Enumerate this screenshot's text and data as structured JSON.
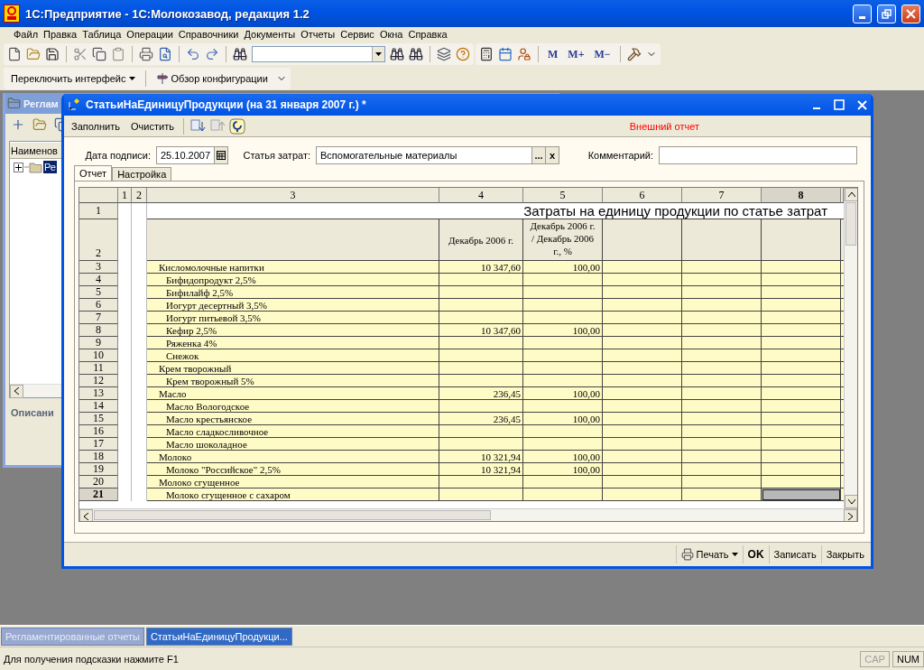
{
  "window": {
    "title": "1С:Предприятие - 1С:Молокозавод, редакция 1.2"
  },
  "menu": [
    "Файл",
    "Правка",
    "Таблица",
    "Операции",
    "Справочники",
    "Документы",
    "Отчеты",
    "Сервис",
    "Окна",
    "Справка"
  ],
  "toolbar": {
    "memory_buttons": [
      "M",
      "M+",
      "M−"
    ]
  },
  "toolbar2": {
    "interface_button": "Переключить интерфейс",
    "config_button": "Обзор конфигурации"
  },
  "background_window": {
    "title": "Реглам",
    "column": "Наименов",
    "tree_item": {
      "label": "Ре",
      "selected": true,
      "expanded": false
    },
    "section": "Описани"
  },
  "dialog": {
    "title": "СтатьиНаЕдиницуПродукции (на 31 января 2007 г.) *",
    "toolbar": [
      "Заполнить",
      "Очистить"
    ],
    "note": "Внешний отчет",
    "fields": {
      "date": {
        "label": "Дата подписи:",
        "value": "25.10.2007"
      },
      "cost_item": {
        "label": "Статья затрат:",
        "value": "Вспомогательные материалы",
        "select_button": "...",
        "clear_button": "x"
      },
      "comment": {
        "label": "Комментарий:"
      }
    },
    "tabs": [
      {
        "label": "Отчет",
        "selected": true
      },
      {
        "label": "Настройка",
        "selected": false
      }
    ],
    "sheet": {
      "columns": [
        {
          "label": "1",
          "selected": false
        },
        {
          "label": "2",
          "selected": false
        },
        {
          "label": "3",
          "selected": false
        },
        {
          "label": "4",
          "selected": false
        },
        {
          "label": "5",
          "selected": false
        },
        {
          "label": "6",
          "selected": false
        },
        {
          "label": "7",
          "selected": false
        },
        {
          "label": "8",
          "selected": true
        }
      ],
      "title_row": {
        "num": "1",
        "text": "Затраты на единицу продукции по статье затрат"
      },
      "header_row": {
        "num": "2",
        "col4": "Декабрь 2006 г.",
        "col5": "Декабрь 2006 г. / Декабрь 2006 г., %"
      },
      "rows": [
        {
          "num": "3",
          "name": "Кисломолочные напитки",
          "col4": "10 347,60",
          "col5": "100,00",
          "selected": false,
          "children": [
            {
              "num": "4",
              "name": "Бифидопродукт 2,5%",
              "selected": false
            },
            {
              "num": "5",
              "name": "Бифилайф 2,5%",
              "selected": false
            },
            {
              "num": "6",
              "name": "Иогурт десертный 3,5%",
              "selected": false
            },
            {
              "num": "7",
              "name": "Иогурт питьевой 3,5%",
              "selected": false
            },
            {
              "num": "8",
              "name": "Кефир 2,5%",
              "col4": "10 347,60",
              "col5": "100,00",
              "selected": false
            },
            {
              "num": "9",
              "name": "Ряженка 4%",
              "selected": false
            },
            {
              "num": "10",
              "name": "Снежок",
              "selected": false
            }
          ]
        },
        {
          "num": "11",
          "name": "Крем творожный",
          "selected": false,
          "children": [
            {
              "num": "12",
              "name": "Крем творожный 5%",
              "selected": false
            }
          ]
        },
        {
          "num": "13",
          "name": "Масло",
          "col4": "236,45",
          "col5": "100,00",
          "selected": false,
          "children": [
            {
              "num": "14",
              "name": "Масло Вологодское",
              "selected": false
            },
            {
              "num": "15",
              "name": "Масло крестьянское",
              "col4": "236,45",
              "col5": "100,00",
              "selected": false
            },
            {
              "num": "16",
              "name": "Масло сладкосливочное",
              "selected": false
            },
            {
              "num": "17",
              "name": "Масло шоколадное",
              "selected": false
            }
          ]
        },
        {
          "num": "18",
          "name": "Молоко",
          "col4": "10 321,94",
          "col5": "100,00",
          "selected": false,
          "children": [
            {
              "num": "19",
              "name": "Молоко  \"Российское\" 2,5%",
              "col4": "10 321,94",
              "col5": "100,00",
              "selected": false
            }
          ]
        },
        {
          "num": "20",
          "name": "Молоко сгущенное",
          "selected": false,
          "children": [
            {
              "num": "21",
              "name": "Молоко сгущенное с сахаром",
              "selected": true
            }
          ]
        }
      ]
    },
    "buttons": [
      {
        "label": "Печать",
        "kind": "menu"
      },
      {
        "label": "OK",
        "kind": "default"
      },
      {
        "label": "Записать",
        "kind": "plain"
      },
      {
        "label": "Закрыть",
        "kind": "plain"
      }
    ]
  },
  "task_tabs": [
    {
      "label": "Регламентированные отчеты",
      "selected": false
    },
    {
      "label": "СтатьиНаЕдиницуПродукци...",
      "selected": true
    }
  ],
  "status_bar": {
    "hint": "Для получения подсказки нажмите F1",
    "indicators": [
      {
        "label": "CAP",
        "on": false
      },
      {
        "label": "NUM",
        "on": true
      }
    ]
  }
}
